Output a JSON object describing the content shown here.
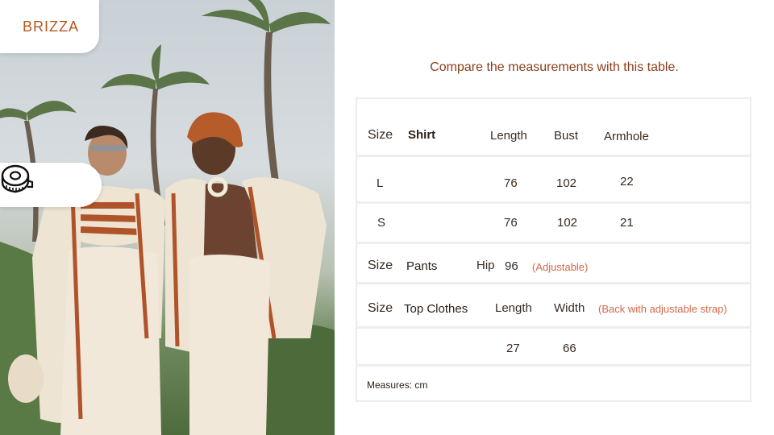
{
  "brand": {
    "logo": "BRIZZA"
  },
  "heading": "Compare the measurements with this table.",
  "icons": {
    "measuring_tape": "measuring-tape-icon"
  },
  "colors": {
    "accent": "#b8561c",
    "heading": "#8a3f1d",
    "note": "#d4684a",
    "text": "#3a2a20"
  },
  "table": {
    "shirt": {
      "size_label": "Size",
      "name": "Shirt",
      "headers": [
        "Length",
        "Bust",
        "Armhole"
      ],
      "rows": [
        {
          "size": "L",
          "length": "76",
          "bust": "102",
          "armhole": "22"
        },
        {
          "size": "S",
          "length": "76",
          "bust": "102",
          "armhole": "21"
        }
      ]
    },
    "pants": {
      "size_label": "Size",
      "name": "Pants",
      "hip_label": "Hip",
      "hip_value": "96",
      "note": "(Adjustable)"
    },
    "top": {
      "size_label": "Size",
      "name": "Top Clothes",
      "headers": [
        "Length",
        "Width"
      ],
      "note": "(Back with adjustable strap)",
      "row": {
        "length": "27",
        "width": "66"
      }
    },
    "footer": "Measures: cm"
  }
}
